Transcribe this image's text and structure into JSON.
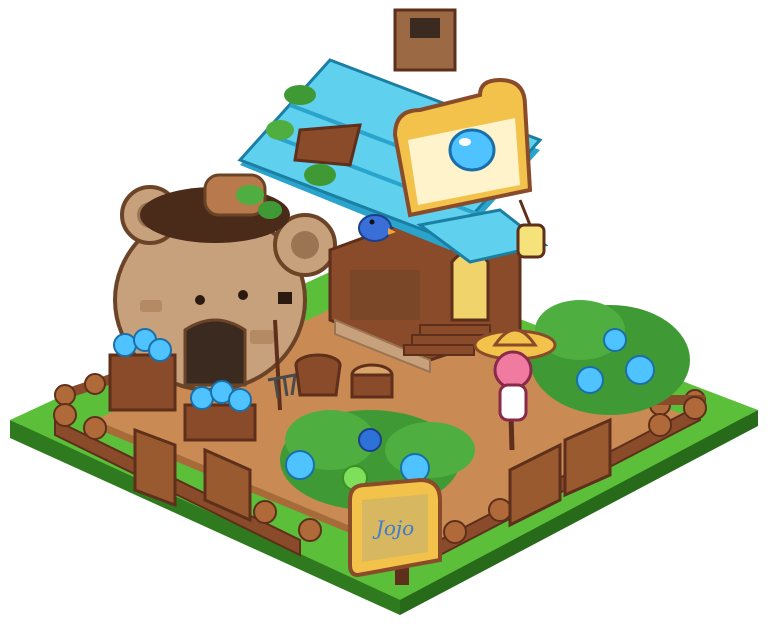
{
  "scene": {
    "sign_text": "Jojo",
    "palette": {
      "grass": "#5bbf3a",
      "grass_dark": "#3c8f27",
      "dirt": "#c98a54",
      "dirt_dark": "#a96a3a",
      "wood": "#8a4b2a",
      "wood_dark": "#5e2f1a",
      "stone": "#c7a07c",
      "stone_dark": "#9b7453",
      "roof": "#5fd0ee",
      "roof_dark": "#2aa4cc",
      "gem": "#4ec3ff",
      "leaf": "#3f9a35",
      "sign_gold": "#f2c24a",
      "sign_blue": "#3a7bd5"
    },
    "icons": {
      "house": "cottage-building",
      "bear": "bear-shaped-storage-hut",
      "scarecrow": "scarecrow",
      "bird": "blue-bird",
      "lantern": "hanging-lantern",
      "sign": "garden-nameplate",
      "crates": "gem-berry-crates",
      "bushes": "gem-berry-bushes",
      "fence": "log-fence",
      "gates": "wooden-gates",
      "pitchfork": "pitchfork",
      "bucket": "wooden-bucket",
      "stump": "tree-stump"
    }
  }
}
